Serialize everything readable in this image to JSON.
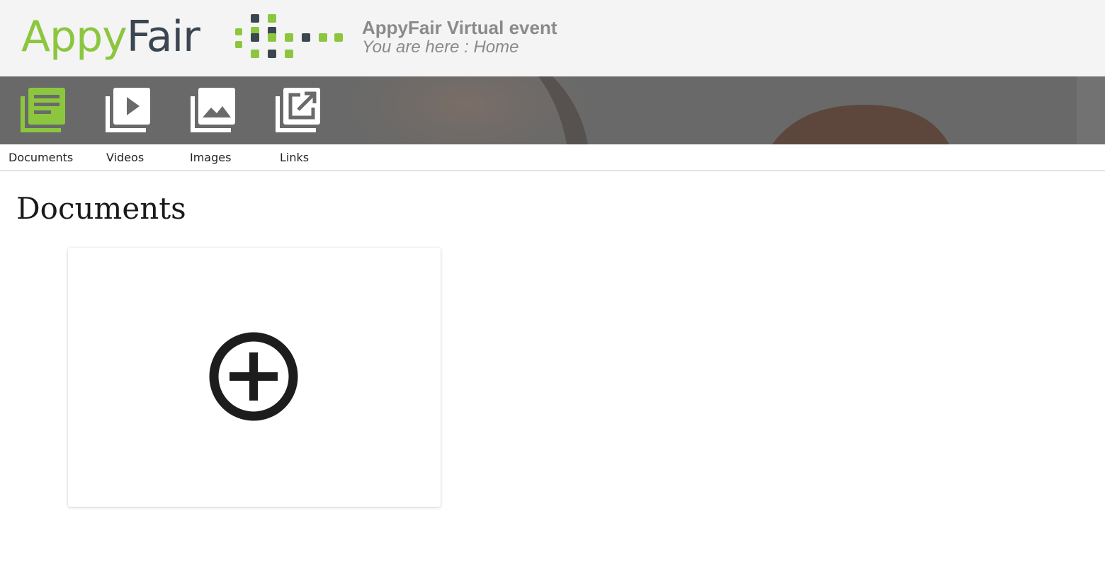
{
  "header": {
    "logo_text_appy": "Appy",
    "logo_text_fair": "Fair",
    "event_title": "AppyFair Virtual event",
    "breadcrumb": "You are here : Home"
  },
  "tabs": [
    {
      "label": "Documents",
      "icon": "documents-icon",
      "active": true
    },
    {
      "label": "Videos",
      "icon": "videos-icon",
      "active": false
    },
    {
      "label": "Images",
      "icon": "images-icon",
      "active": false
    },
    {
      "label": "Links",
      "icon": "links-icon",
      "active": false
    }
  ],
  "main": {
    "title": "Documents",
    "add_icon": "add-circle-icon"
  },
  "colors": {
    "brand_green": "#8cc63f",
    "brand_dark": "#3b4650",
    "header_text": "#8a8a8a",
    "banner_bg": "#6a6a6a"
  }
}
